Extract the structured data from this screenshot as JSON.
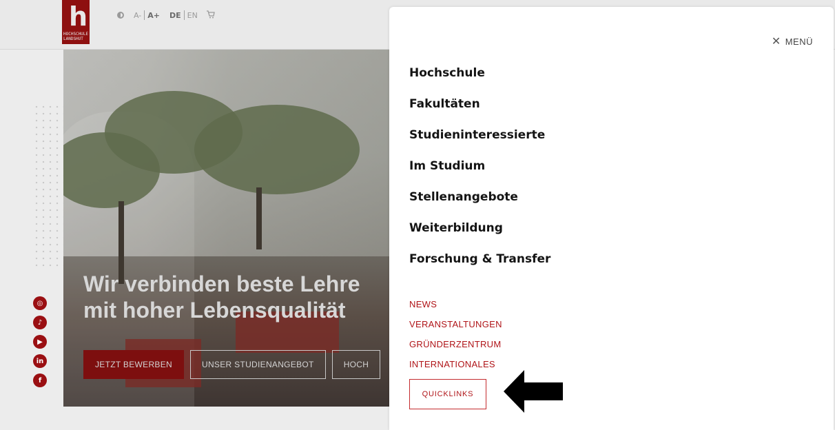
{
  "header": {
    "logo_letter": "h",
    "logo_text": "HOCHSCHULE LANDSHUT",
    "font_small": "A-",
    "font_large": "A+",
    "lang_de": "DE",
    "lang_en": "EN",
    "cart_icon": "cart-icon",
    "contrast_icon": "contrast-icon"
  },
  "hero": {
    "headline_line1": "Wir verbinden beste Lehre",
    "headline_line2": "mit hoher Lebensqualität",
    "buttons": [
      "JETZT BEWERBEN",
      "UNSER STUDIENANGEBOT",
      "HOCH"
    ]
  },
  "social": [
    "instagram-icon",
    "tiktok-icon",
    "youtube-icon",
    "linkedin-icon",
    "facebook-icon"
  ],
  "menu": {
    "close_label": "MENÜ",
    "main_items": [
      "Hochschule",
      "Fakultäten",
      "Studieninteressierte",
      "Im Studium",
      "Stellenangebote",
      "Weiterbildung",
      "Forschung & Transfer"
    ],
    "sub_items": [
      "NEWS",
      "VERANSTALTUNGEN",
      "GRÜNDERZENTRUM",
      "INTERNATIONALES"
    ],
    "quicklinks_label": "QUICKLINKS"
  },
  "colors": {
    "brand_red": "#b01418",
    "dark_red": "#7d0f0f",
    "text_dark": "#141414"
  }
}
